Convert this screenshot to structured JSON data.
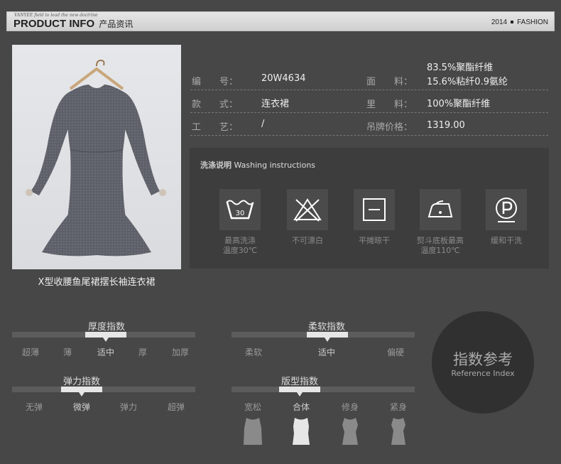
{
  "header": {
    "brand_tag": "VANYEE field to lead the new doctrine",
    "title_en": "PRODUCT INFO",
    "title_cn": "产品资讯",
    "year": "2014",
    "right_label": "FASHION"
  },
  "product": {
    "caption": "X型收腰鱼尾裙摆长袖连衣裙"
  },
  "info": {
    "code_label": "编　　号：",
    "code_value": "20W4634",
    "fabric_label": "面　　料：",
    "fabric_line1": "83.5%聚酯纤维",
    "fabric_line2": "15.6%粘纤0.9氨纶",
    "style_label": "款　　式：",
    "style_value": "连衣裙",
    "lining_label": "里　　料：",
    "lining_value": "100%聚酯纤维",
    "craft_label": "工　　艺：",
    "craft_value": "/",
    "price_label": "吊牌价格：",
    "price_value": "1319.00"
  },
  "washing": {
    "title_cn": "洗涤说明",
    "title_en": "Washing instructions",
    "temp_badge": "30",
    "items": [
      {
        "icon": "wash-30-icon",
        "line1": "最高洗涤",
        "line2": "温度30℃"
      },
      {
        "icon": "no-bleach-icon",
        "line1": "不可漂白",
        "line2": ""
      },
      {
        "icon": "flat-dry-icon",
        "line1": "平摊晾干",
        "line2": ""
      },
      {
        "icon": "iron-110-icon",
        "line1": "熨斗底板最高",
        "line2": "温度110℃"
      },
      {
        "icon": "dry-clean-p-icon",
        "line1": "缓和干洗",
        "line2": ""
      }
    ]
  },
  "indices": {
    "thickness": {
      "title": "厚度指数",
      "ticks": [
        "超薄",
        "薄",
        "适中",
        "厚",
        "加厚"
      ],
      "selected": "适中"
    },
    "softness": {
      "title": "柔软指数",
      "ticks": [
        "柔软",
        "适中",
        "偏硬"
      ],
      "selected": "适中"
    },
    "elasticity": {
      "title": "弹力指数",
      "ticks": [
        "无弹",
        "微弹",
        "弹力",
        "超弹"
      ],
      "selected": "微弹"
    },
    "fit": {
      "title": "版型指数",
      "ticks": [
        "宽松",
        "合体",
        "修身",
        "紧身"
      ],
      "selected": "合体"
    }
  },
  "reference": {
    "title_cn": "指数参考",
    "title_en": "Reference Index"
  },
  "colors": {
    "background": "#474747",
    "highlight": "#e6e6e6",
    "track": "#5c5c5c"
  }
}
